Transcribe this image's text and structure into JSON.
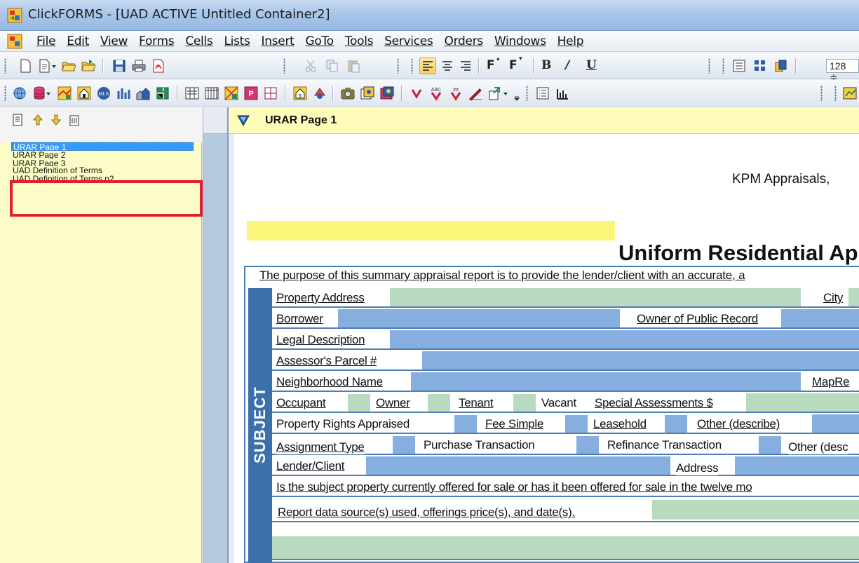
{
  "window": {
    "title": "ClickFORMS - [UAD ACTIVE Untitled Container2]"
  },
  "menu": {
    "items": [
      {
        "label": "File"
      },
      {
        "label": "Edit"
      },
      {
        "label": "View"
      },
      {
        "label": "Forms"
      },
      {
        "label": "Cells"
      },
      {
        "label": "Lists"
      },
      {
        "label": "Insert"
      },
      {
        "label": "GoTo"
      },
      {
        "label": "Tools"
      },
      {
        "label": "Services"
      },
      {
        "label": "Orders"
      },
      {
        "label": "Windows"
      },
      {
        "label": "Help"
      }
    ]
  },
  "toolbar": {
    "font_size": "128 ≑",
    "bold_label": "B",
    "italic_label": "/",
    "underline_label": "U",
    "font_up_label": "F",
    "font_down_label": "F"
  },
  "nav": {
    "pages": [
      {
        "label": "URAR Page 1",
        "selected": true
      },
      {
        "label": "URAR Page 2"
      },
      {
        "label": "URAR Page 3"
      },
      {
        "label": "UAD Definition of Terms"
      },
      {
        "label": "UAD Definition of Terms p2"
      }
    ]
  },
  "form": {
    "page_title": "URAR Page 1",
    "company": "KPM Appraisals,",
    "title": "Uniform Residential Ap",
    "purpose": "The purpose of this summary appraisal report is to provide the lender/client with an accurate, a",
    "section": "SUBJECT",
    "labels": {
      "property_address": "Property  Address",
      "city": "City",
      "borrower": "Borrower",
      "owner_public_record": "Owner of Public Record",
      "legal_description": "Legal Description",
      "assessors_parcel": "Assessor's Parcel #",
      "neighborhood_name": "Neighborhood Name",
      "map_ref": "MapRe",
      "occupant": "Occupant",
      "owner": "Owner",
      "tenant": "Tenant",
      "vacant": "Vacant",
      "special_assessments": "Special Assessments $",
      "property_rights": "Property Rights Appraised",
      "fee_simple": "Fee Simple",
      "leasehold": "Leasehold",
      "other_describe": "Other (describe)",
      "assignment_type": "Assignment Type",
      "purchase_transaction": "Purchase Transaction",
      "refinance_transaction": "Refinance Transaction",
      "other_desc": "Other (desc",
      "lender_client": "Lender/Client",
      "address": "Address",
      "offered_for_sale": "Is the subject property currently offered for sale or has it been offered for sale in the twelve mo",
      "report_data_source": "Report data source(s) used, offerings price(s), and date(s)."
    }
  },
  "colors": {
    "field_green": "#b8dbc0",
    "field_blue": "#86aede",
    "section_blue": "#3b70ab",
    "nav_background": "#fcfcc6",
    "highlight_red": "#e0202c"
  }
}
